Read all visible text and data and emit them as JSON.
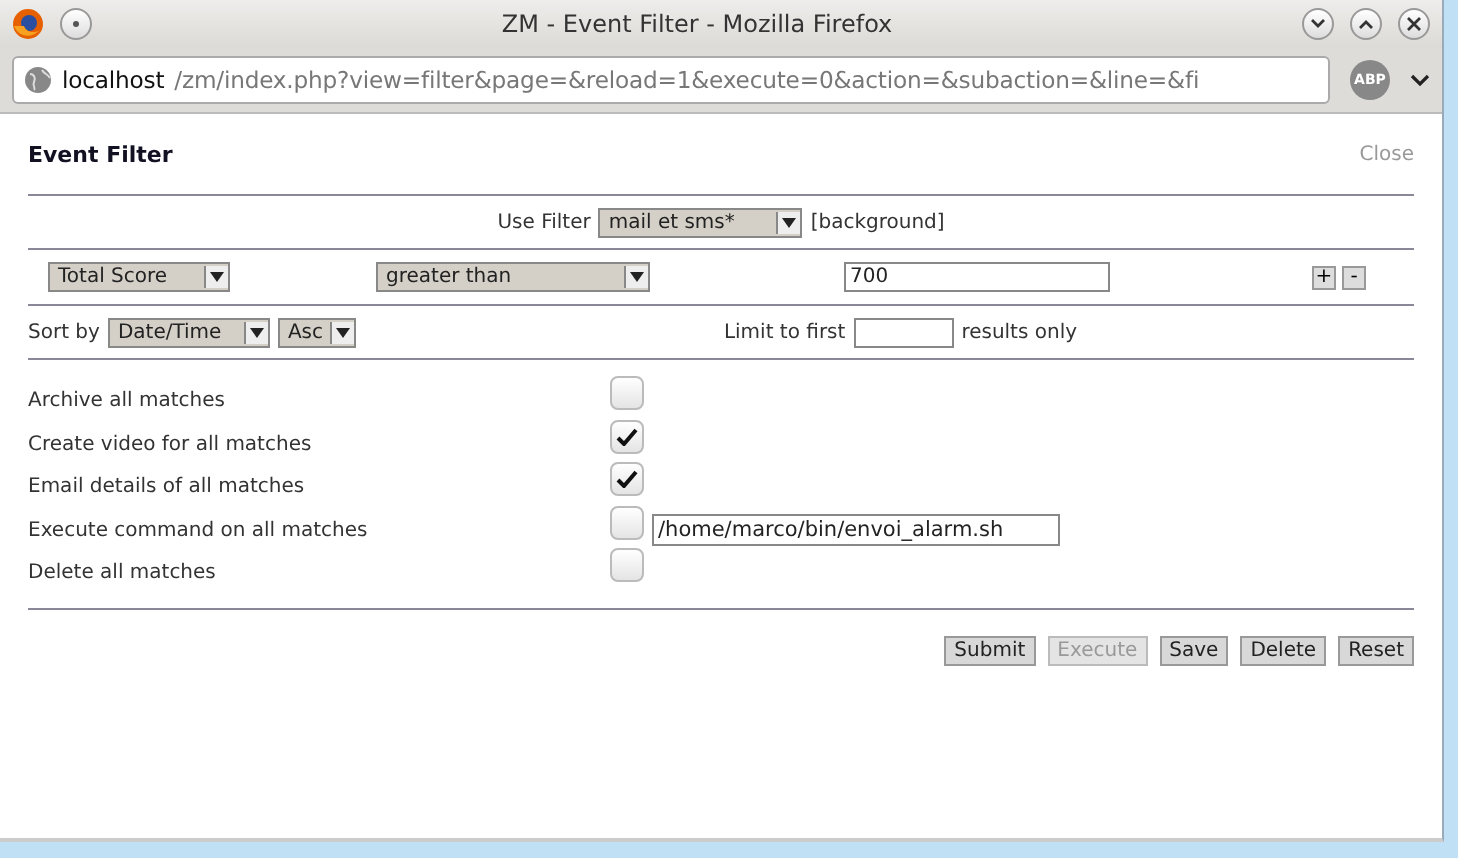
{
  "window": {
    "title": "ZM - Event Filter - Mozilla Firefox"
  },
  "url_bar": {
    "host": "localhost",
    "path": "/zm/index.php?view=filter&page=&reload=1&execute=0&action=&subaction=&line=&fi",
    "addon_label": "ABP"
  },
  "header": {
    "title": "Event Filter",
    "close_link": "Close"
  },
  "use_filter": {
    "label": "Use Filter",
    "value": "mail et sms*",
    "note": "[background]"
  },
  "term": {
    "attribute": "Total Score",
    "operator": "greater than",
    "value": "700",
    "add_button": "+",
    "remove_button": "-"
  },
  "sort": {
    "label": "Sort by",
    "field": "Date/Time",
    "order": "Asc",
    "limit_label": "Limit to first",
    "limit_suffix": "results only"
  },
  "actions": [
    {
      "label": "Archive all matches",
      "checked": false
    },
    {
      "label": "Create video for all matches",
      "checked": true
    },
    {
      "label": "Email details of all matches",
      "checked": true
    },
    {
      "label": "Execute command on all matches",
      "checked": false,
      "command": "/home/marco/bin/envoi_alarm.sh"
    },
    {
      "label": "Delete all matches",
      "checked": false
    }
  ],
  "buttons": [
    {
      "label": "Submit",
      "disabled": false
    },
    {
      "label": "Execute",
      "disabled": true
    },
    {
      "label": "Save",
      "disabled": false
    },
    {
      "label": "Delete",
      "disabled": false
    },
    {
      "label": "Reset",
      "disabled": false
    }
  ]
}
